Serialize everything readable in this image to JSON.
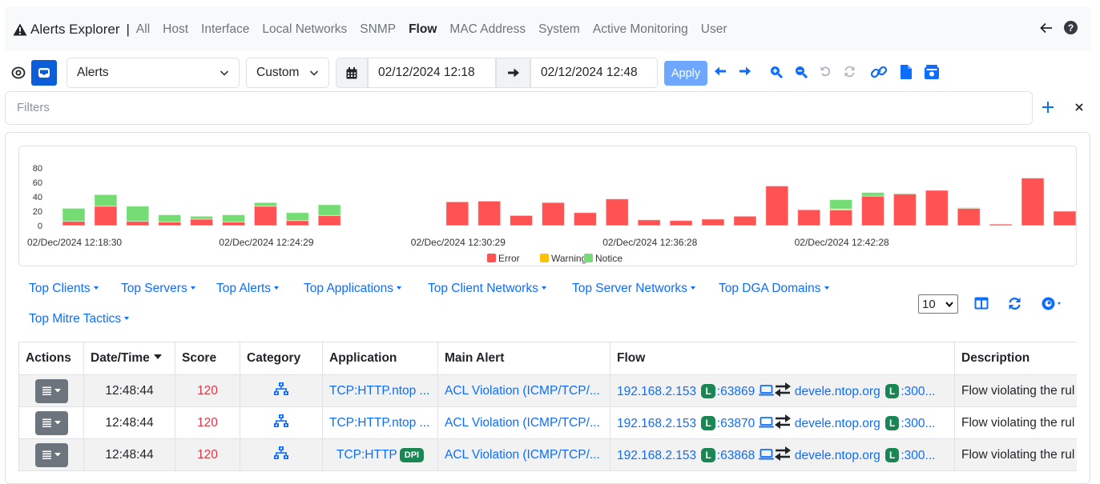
{
  "nav": {
    "title": "Alerts Explorer",
    "separator": "|",
    "links": [
      {
        "label": "All",
        "active": false
      },
      {
        "label": "Host",
        "active": false
      },
      {
        "label": "Interface",
        "active": false
      },
      {
        "label": "Local Networks",
        "active": false
      },
      {
        "label": "SNMP",
        "active": false
      },
      {
        "label": "Flow",
        "active": true
      },
      {
        "label": "MAC Address",
        "active": false
      },
      {
        "label": "System",
        "active": false
      },
      {
        "label": "Active Monitoring",
        "active": false
      },
      {
        "label": "User",
        "active": false
      }
    ],
    "icons": [
      "back-arrow-icon",
      "help-icon"
    ]
  },
  "toolbar": {
    "view_select": "Alerts",
    "range_select": "Custom",
    "date_from": "02/12/2024 12:18",
    "date_to": "02/12/2024 12:48",
    "apply_label": "Apply",
    "icons": [
      "arrow-left-icon",
      "arrow-right-icon",
      "zoom-in-icon",
      "zoom-out-icon",
      "undo-icon",
      "refresh-icon",
      "link-icon",
      "file-icon",
      "snapshot-icon"
    ]
  },
  "filters": {
    "placeholder": "Filters",
    "add_label": "+",
    "clear_label": "×"
  },
  "chart_data": {
    "type": "bar",
    "stacked": true,
    "title": "",
    "xlabel": "",
    "ylabel": "",
    "ylim": [
      0,
      80
    ],
    "yticks": [
      0,
      20,
      40,
      60,
      80
    ],
    "xtick_labels": [
      {
        "index": 0,
        "label": "02/Dec/2024 12:18:30"
      },
      {
        "index": 6,
        "label": "02/Dec/2024 12:24:29"
      },
      {
        "index": 12,
        "label": "02/Dec/2024 12:30:29"
      },
      {
        "index": 18,
        "label": "02/Dec/2024 12:36:28"
      },
      {
        "index": 24,
        "label": "02/Dec/2024 12:42:28"
      }
    ],
    "legend": {
      "position": "bottom",
      "entries": [
        "Error",
        "Warning",
        "Notice"
      ]
    },
    "colors": {
      "Error": "#ff5252",
      "Warning": "#ffc107",
      "Notice": "#73dc73"
    },
    "series": [
      {
        "name": "Error",
        "values": [
          6,
          27,
          6,
          5,
          9,
          5,
          27,
          7,
          14,
          0,
          0,
          0,
          33,
          34,
          14,
          32,
          18,
          37,
          8,
          7,
          9,
          13,
          55,
          22,
          22,
          41,
          44,
          49,
          24,
          2,
          66,
          20
        ]
      },
      {
        "name": "Warning",
        "values": [
          0,
          0,
          0,
          0,
          0,
          0,
          0,
          0,
          0,
          0,
          0,
          0,
          0,
          0,
          0,
          0,
          0,
          0,
          0,
          0,
          0,
          0,
          0,
          0,
          1,
          0,
          0,
          0,
          0,
          0,
          0,
          0
        ]
      },
      {
        "name": "Notice",
        "values": [
          18,
          16,
          21,
          10,
          4,
          10,
          5,
          11,
          15,
          0,
          0,
          0,
          0,
          0,
          0,
          0,
          0,
          0,
          0,
          0,
          0,
          0,
          0,
          0,
          13,
          5,
          1,
          0,
          1,
          0,
          0,
          0
        ]
      }
    ]
  },
  "top_links": [
    "Top Clients",
    "Top Servers",
    "Top Alerts",
    "Top Applications",
    "Top Client Networks",
    "Top Server Networks",
    "Top DGA Domains",
    "Top Mitre Tactics"
  ],
  "table_controls": {
    "page_size": "10",
    "icons": [
      "columns-icon",
      "reload-icon",
      "eye-dropdown-icon"
    ]
  },
  "table": {
    "columns": [
      "Actions",
      "Date/Time",
      "Score",
      "Category",
      "Application",
      "Main Alert",
      "Flow",
      "Description"
    ],
    "sorted_column": "Date/Time",
    "rows": [
      {
        "time": "12:48:44",
        "score": "120",
        "application": "TCP:HTTP.ntop ...",
        "dpi": false,
        "main_alert": "ACL Violation (ICMP/TCP/...",
        "src": "192.168.2.153",
        "src_badge": "L",
        "src_port": ":63869",
        "dst": "devele.ntop.org",
        "dst_badge": "L",
        "dst_port": ":300...",
        "description": "Flow violating the rul"
      },
      {
        "time": "12:48:44",
        "score": "120",
        "application": "TCP:HTTP.ntop ...",
        "dpi": false,
        "main_alert": "ACL Violation (ICMP/TCP/...",
        "src": "192.168.2.153",
        "src_badge": "L",
        "src_port": ":63870",
        "dst": "devele.ntop.org",
        "dst_badge": "L",
        "dst_port": ":300...",
        "description": "Flow violating the rul"
      },
      {
        "time": "12:48:44",
        "score": "120",
        "application": "TCP:HTTP",
        "dpi": true,
        "dpi_label": "DPI",
        "main_alert": "ACL Violation (ICMP/TCP/...",
        "src": "192.168.2.153",
        "src_badge": "L",
        "src_port": ":63868",
        "dst": "devele.ntop.org",
        "dst_badge": "L",
        "dst_port": ":300...",
        "description": "Flow violating the rul"
      }
    ]
  }
}
